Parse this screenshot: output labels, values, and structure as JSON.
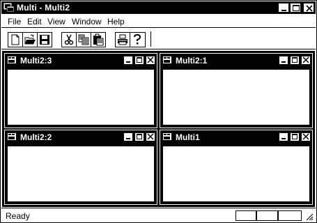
{
  "window": {
    "title": "Multi - Multi2"
  },
  "menu": {
    "items": [
      "File",
      "Edit",
      "View",
      "Window",
      "Help"
    ]
  },
  "toolbar": {
    "buttons": [
      {
        "icon": "new-file-icon"
      },
      {
        "icon": "open-folder-icon"
      },
      {
        "icon": "save-disk-icon"
      },
      {
        "icon": "cut-scissors-icon"
      },
      {
        "icon": "copy-icon"
      },
      {
        "icon": "paste-clipboard-icon"
      },
      {
        "icon": "print-icon"
      },
      {
        "icon": "help-question-icon"
      }
    ]
  },
  "children": [
    {
      "title": "Multi2:3"
    },
    {
      "title": "Multi2:1"
    },
    {
      "title": "Multi2:2"
    },
    {
      "title": "Multi1"
    }
  ],
  "status": {
    "text": "Ready"
  },
  "colors": {
    "titlebar_bg": "#000000",
    "titlebar_fg": "#ffffff",
    "background": "#ffffff"
  }
}
